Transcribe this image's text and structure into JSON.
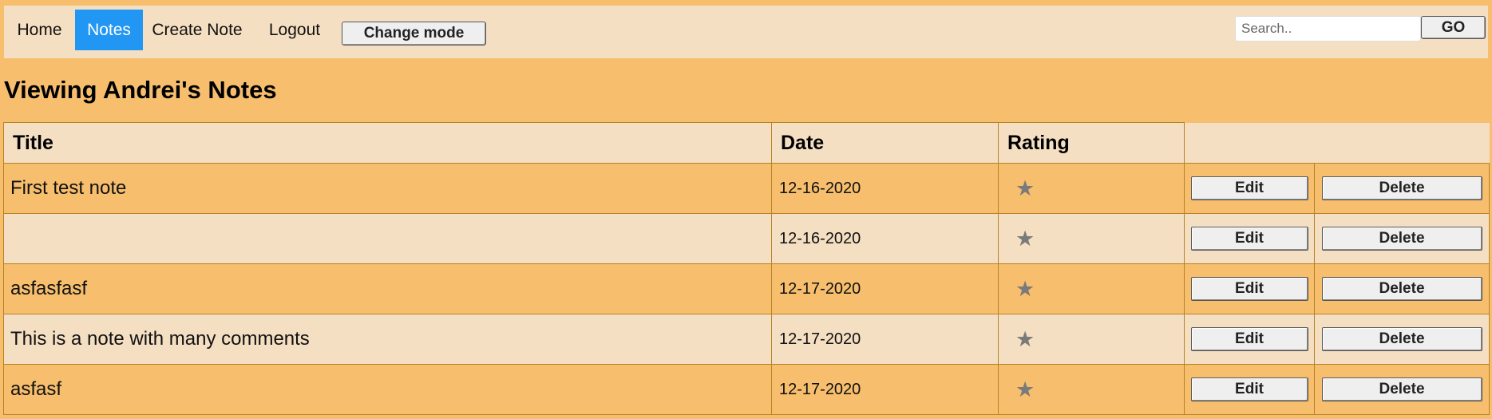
{
  "nav": {
    "home_label": "Home",
    "notes_label": "Notes",
    "create_label": "Create Note",
    "logout_label": "Logout",
    "mode_label": "Change mode"
  },
  "search": {
    "placeholder": "Search..",
    "value": "",
    "go_label": "GO"
  },
  "page": {
    "title": "Viewing Andrei's Notes"
  },
  "table": {
    "headers": {
      "title": "Title",
      "date": "Date",
      "rating": "Rating",
      "actions": ""
    },
    "rows": [
      {
        "title": "First test note",
        "date": "12-16-2020",
        "rating_icon": "star-icon",
        "edit_label": "Edit",
        "delete_label": "Delete"
      },
      {
        "title": "",
        "date": "12-16-2020",
        "rating_icon": "star-icon",
        "edit_label": "Edit",
        "delete_label": "Delete"
      },
      {
        "title": "asfasfasf",
        "date": "12-17-2020",
        "rating_icon": "star-icon",
        "edit_label": "Edit",
        "delete_label": "Delete"
      },
      {
        "title": "This is a note with many comments",
        "date": "12-17-2020",
        "rating_icon": "star-icon",
        "edit_label": "Edit",
        "delete_label": "Delete"
      },
      {
        "title": "asfasf",
        "date": "12-17-2020",
        "rating_icon": "star-icon",
        "edit_label": "Edit",
        "delete_label": "Delete"
      }
    ]
  },
  "colors": {
    "page_background": "#f7be6d",
    "light_band": "#f5dfc2",
    "active_nav": "#2196f3",
    "border": "#b58324",
    "star": "#7a7a7a"
  }
}
